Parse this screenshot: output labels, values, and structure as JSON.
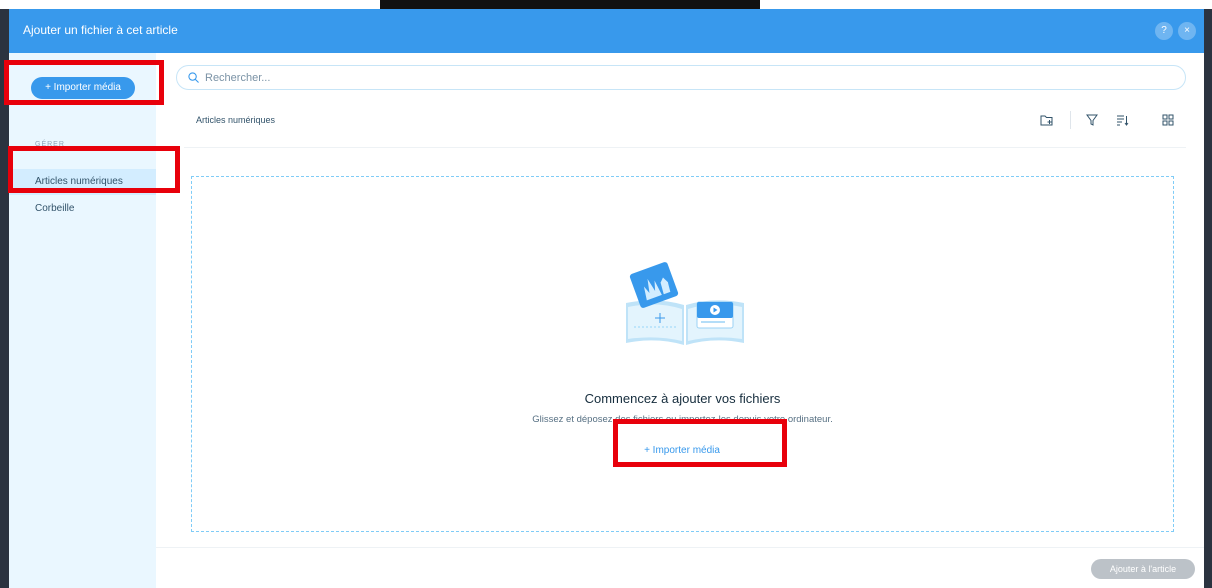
{
  "header": {
    "title": "Ajouter un fichier à cet article",
    "help_label": "?",
    "close_label": "×"
  },
  "sidebar": {
    "import_label": "+ Importer média",
    "section_label": "GÉRER",
    "items": [
      {
        "label": "Articles numériques",
        "active": true
      },
      {
        "label": "Corbeille",
        "active": false
      }
    ]
  },
  "search": {
    "placeholder": "Rechercher..."
  },
  "breadcrumb": "Articles numériques",
  "toolbar": {
    "icons": [
      "new-folder-icon",
      "filter-icon",
      "sort-icon",
      "grid-view-icon"
    ]
  },
  "empty_state": {
    "title": "Commencez à ajouter vos fichiers",
    "subtitle": "Glissez et déposez des fichiers ou importez-les depuis votre ordinateur.",
    "import_link": "+ Importer média"
  },
  "footer": {
    "add_button": "Ajouter à l'article"
  },
  "colors": {
    "accent": "#3899ec",
    "highlight": "#e8000b",
    "sidebar_bg": "#eaf7ff",
    "disabled": "#bcc2c8"
  }
}
